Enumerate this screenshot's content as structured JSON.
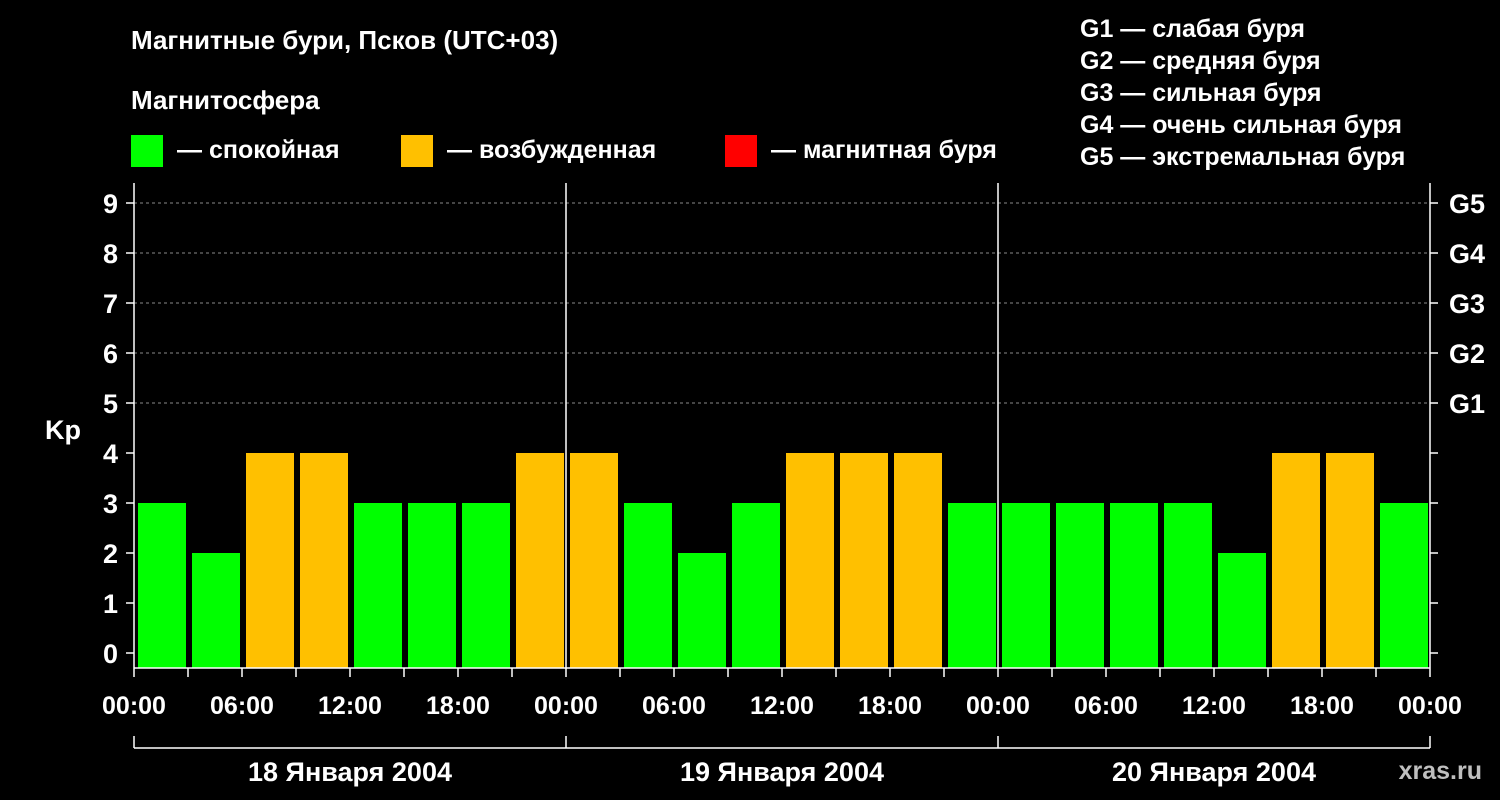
{
  "title": "Магнитные бури, Псков (UTC+03)",
  "subtitle": "Магнитосфера",
  "legend": [
    {
      "label": "— спокойная",
      "color": "#00ff00"
    },
    {
      "label": "— возбужденная",
      "color": "#ffc000"
    },
    {
      "label": "— магнитная буря",
      "color": "#ff0000"
    }
  ],
  "storm_levels": [
    "G1 — слабая буря",
    "G2 — средняя буря",
    "G3 — сильная буря",
    "G4 — очень сильная буря",
    "G5 — экстремальная буря"
  ],
  "watermark": "xras.ru",
  "chart_data": {
    "type": "bar",
    "ylabel": "Kp",
    "ylim": [
      0,
      9
    ],
    "y_ticks": [
      0,
      1,
      2,
      3,
      4,
      5,
      6,
      7,
      8,
      9
    ],
    "right_axis_labels": [
      {
        "kp": 5,
        "label": "G1"
      },
      {
        "kp": 6,
        "label": "G2"
      },
      {
        "kp": 7,
        "label": "G3"
      },
      {
        "kp": 8,
        "label": "G4"
      },
      {
        "kp": 9,
        "label": "G5"
      }
    ],
    "grid": "dashed horizontal at Kp 5-9",
    "time_ticks": [
      "00:00",
      "06:00",
      "12:00",
      "18:00",
      "00:00",
      "06:00",
      "12:00",
      "18:00",
      "00:00",
      "06:00",
      "12:00",
      "18:00",
      "00:00"
    ],
    "days": [
      "18 Января 2004",
      "19 Января 2004",
      "20 Января 2004"
    ],
    "interval_hours": 3,
    "values": [
      3,
      2,
      4,
      4,
      3,
      3,
      3,
      4,
      4,
      3,
      2,
      3,
      4,
      4,
      4,
      3,
      3,
      3,
      3,
      3,
      2,
      4,
      4,
      3
    ],
    "colors": {
      "quiet": "#00ff00",
      "active": "#ffc000",
      "storm": "#ff0000"
    },
    "thresholds": {
      "active_min": 4,
      "storm_min": 5
    }
  }
}
